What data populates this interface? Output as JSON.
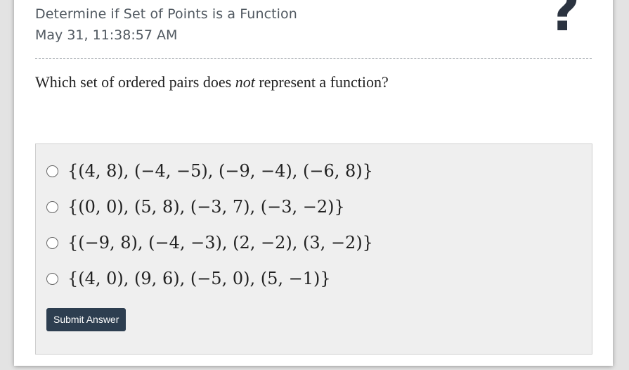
{
  "header": {
    "title": "Determine if Set of Points is a Function",
    "timestamp": "May 31, 11:38:57 AM",
    "help_glyph": "?",
    "help_icon": "question-mark-icon"
  },
  "question": {
    "prefix": "Which set of ordered pairs does ",
    "emphasis": "not",
    "suffix": " represent a function?"
  },
  "choices": [
    {
      "label": "{(4, 8), (−4, −5), (−9, −4), (−6, 8)}"
    },
    {
      "label": "{(0, 0), (5, 8), (−3, 7), (−3, −2)}"
    },
    {
      "label": "{(−9, 8), (−4, −3), (2, −2), (3, −2)}"
    },
    {
      "label": "{(4, 0), (9, 6), (−5, 0), (5, −1)}"
    }
  ],
  "submit": {
    "label": "Submit Answer"
  },
  "colors": {
    "submit_bg": "#2d3e50",
    "answer_box_bg": "#efefef",
    "help_icon": "#2b3340"
  }
}
